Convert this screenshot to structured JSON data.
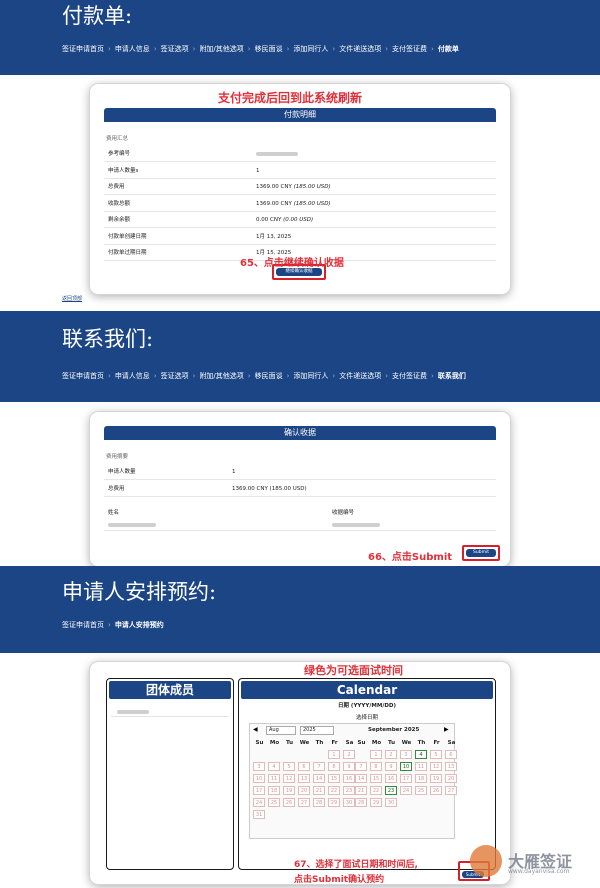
{
  "section1": {
    "title": "付款单:",
    "breadcrumb": [
      "签证申请首页",
      "申请人信息",
      "签证选项",
      "附加/其他选项",
      "移民面谈",
      "添加同行人",
      "文件递送选项",
      "支付签证费",
      "付款单"
    ],
    "annotation_top": "支付完成后回到此系统刷新",
    "card_title": "付款明细",
    "summary_label": "费用汇总",
    "rows": [
      {
        "k": "参考编号",
        "v": ""
      },
      {
        "k": "申请人数量s",
        "v": "1"
      },
      {
        "k": "总费用",
        "v": "1369.00 CNY",
        "vi": "(185.00 USD)"
      },
      {
        "k": "收款总额",
        "v": "1369.00 CNY",
        "vi": "(185.00 USD)"
      },
      {
        "k": "剩余余额",
        "v": "0.00 CNY",
        "vi": "(0.00 USD)"
      },
      {
        "k": "付款单创建日期",
        "v": "1月 13, 2025"
      },
      {
        "k": "付款单过期日期",
        "v": "1月 15, 2025"
      }
    ],
    "annotation_step": "65、点击继续确认收据",
    "continue_button": "继续确认收据",
    "back_link": "返回顶部"
  },
  "section2": {
    "title": "联系我们:",
    "breadcrumb": [
      "签证申请首页",
      "申请人信息",
      "签证选项",
      "附加/其他选项",
      "移民面谈",
      "添加同行人",
      "文件递送选项",
      "支付签证费",
      "联系我们"
    ],
    "card_title": "确认收据",
    "summary_label": "费用摘要",
    "rows": [
      {
        "k": "申请人数量",
        "v": "1"
      },
      {
        "k": "总费用",
        "v": "1369.00 CNY (185.00 USD)"
      }
    ],
    "name_label": "姓名",
    "receipt_label": "收据编号",
    "annotation_step": "66、点击Submit",
    "submit_button": "Submit"
  },
  "section3": {
    "title": "申请人安排预约:",
    "breadcrumb": [
      "签证申请首页",
      "申请人安排预约"
    ],
    "annotation_top": "绿色为可选面试时间",
    "members_title": "团体成员",
    "calendar_title": "Calendar",
    "date_format": "日期 (YYYY/MM/DD)",
    "select_date": "选择日期",
    "month_select": "Aug",
    "year_select": "2025",
    "month_title": "September 2025",
    "weekdays": [
      "Su",
      "Mo",
      "Tu",
      "We",
      "Th",
      "Fr",
      "Sa"
    ],
    "annotation_step_line1": "67、选择了面试日期和时间后,",
    "annotation_step_line2": "点击Submit确认预约",
    "submit_button": "Submit"
  },
  "watermark": {
    "brand": "大雁签证",
    "url": "www.dayanvisa.com"
  },
  "colors": {
    "navy": "#1c4586",
    "red": "#e0303a",
    "available": "#2e8b3a"
  }
}
